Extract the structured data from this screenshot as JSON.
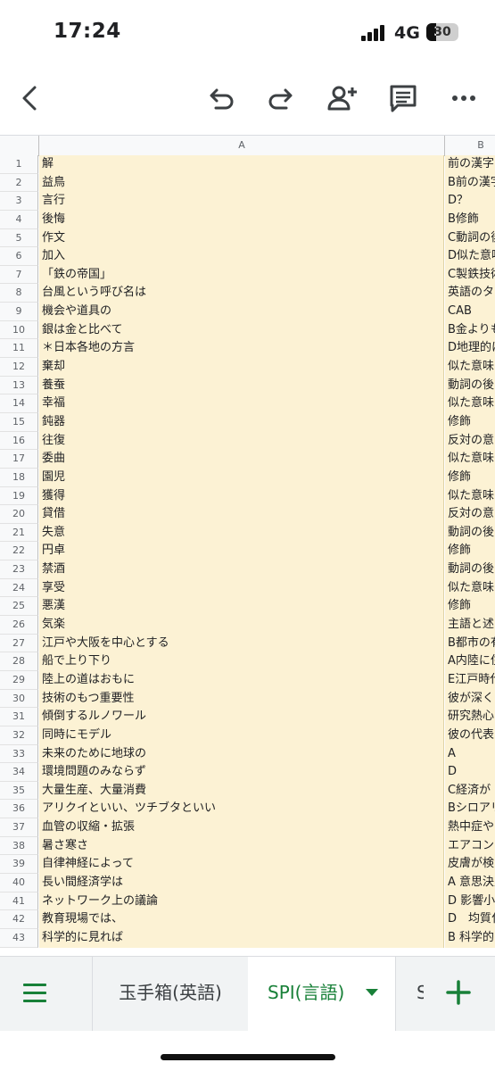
{
  "status_bar": {
    "time": "17:24",
    "network": "4G",
    "battery": "30",
    "battery_level": 0.3
  },
  "toolbar": {
    "icons": [
      "back-chevron-icon",
      "undo-icon",
      "redo-icon",
      "share-person-add-icon",
      "comment-icon",
      "more-horiz-icon"
    ]
  },
  "sheet": {
    "columns": [
      "A",
      "B"
    ],
    "rows": [
      {
        "n": "1",
        "a": "解",
        "b": "前の漢字"
      },
      {
        "n": "2",
        "a": "益鳥",
        "b": "B前の漢字"
      },
      {
        "n": "3",
        "a": "言行",
        "b": "D？"
      },
      {
        "n": "4",
        "a": "後悔",
        "b": "B修飾"
      },
      {
        "n": "5",
        "a": "作文",
        "b": "C動詞の後"
      },
      {
        "n": "6",
        "a": "加入",
        "b": "D似た意味"
      },
      {
        "n": "7",
        "a": "「鉄の帝国」",
        "b": "C製鉄技術"
      },
      {
        "n": "8",
        "a": "台風という呼び名は",
        "b": "英語のタ"
      },
      {
        "n": "9",
        "a": "機会や道具の",
        "b": "CAB"
      },
      {
        "n": "10",
        "a": "銀は金と比べて",
        "b": "B金よりも"
      },
      {
        "n": "11",
        "a": "＊日本各地の方言",
        "b": "D地理的に"
      },
      {
        "n": "12",
        "a": "棄却",
        "b": "似た意味"
      },
      {
        "n": "13",
        "a": "養蚕",
        "b": "動詞の後"
      },
      {
        "n": "14",
        "a": "幸福",
        "b": "似た意味"
      },
      {
        "n": "15",
        "a": "鈍器",
        "b": "修飾"
      },
      {
        "n": "16",
        "a": "往復",
        "b": "反対の意"
      },
      {
        "n": "17",
        "a": "委曲",
        "b": "似た意味"
      },
      {
        "n": "18",
        "a": "園児",
        "b": "修飾"
      },
      {
        "n": "19",
        "a": "獲得",
        "b": "似た意味"
      },
      {
        "n": "20",
        "a": "貸借",
        "b": "反対の意"
      },
      {
        "n": "21",
        "a": "失意",
        "b": "動詞の後"
      },
      {
        "n": "22",
        "a": "円卓",
        "b": "修飾"
      },
      {
        "n": "23",
        "a": "禁酒",
        "b": "動詞の後"
      },
      {
        "n": "24",
        "a": "享受",
        "b": "似た意味"
      },
      {
        "n": "25",
        "a": "悪漢",
        "b": "修飾"
      },
      {
        "n": "26",
        "a": "気楽",
        "b": "主語と述"
      },
      {
        "n": "27",
        "a": "江戸や大阪を中心とする",
        "b": "B都市の有"
      },
      {
        "n": "28",
        "a": "船で上り下り",
        "b": "A内陸に住"
      },
      {
        "n": "29",
        "a": "陸上の道はおもに",
        "b": "E江戸時代"
      },
      {
        "n": "30",
        "a": "技術のもつ重要性",
        "b": "彼が深く"
      },
      {
        "n": "31",
        "a": "傾倒するルノワール",
        "b": "研究熱心"
      },
      {
        "n": "32",
        "a": "同時にモデル",
        "b": "彼の代表"
      },
      {
        "n": "33",
        "a": "未来のために地球の",
        "b": "A"
      },
      {
        "n": "34",
        "a": "環境問題のみならず",
        "b": "D"
      },
      {
        "n": "35",
        "a": "大量生産、大量消費",
        "b": "C経済が"
      },
      {
        "n": "36",
        "a": "アリクイといい、ツチブタといい",
        "b": "Bシロアリ"
      },
      {
        "n": "37",
        "a": "血管の収縮・拡張",
        "b": "熱中症や"
      },
      {
        "n": "38",
        "a": "暑さ寒さ",
        "b": "エアコン"
      },
      {
        "n": "39",
        "a": "自律神経によって",
        "b": "皮膚が検"
      },
      {
        "n": "40",
        "a": "長い間経済学は",
        "b": "A 意思決定"
      },
      {
        "n": "41",
        "a": "ネットワーク上の議論",
        "b": "D 影響小"
      },
      {
        "n": "42",
        "a": "教育現場では、",
        "b": "D　均質化"
      },
      {
        "n": "43",
        "a": "科学的に見れば",
        "b": "B 科学的"
      }
    ]
  },
  "sheet_tabs": {
    "tab1": "玉手箱(英語)",
    "tab2": "SPI(言語)",
    "tab3": "S"
  },
  "colors": {
    "accent": "#188038",
    "cell_fill": "#fcf2d4"
  }
}
